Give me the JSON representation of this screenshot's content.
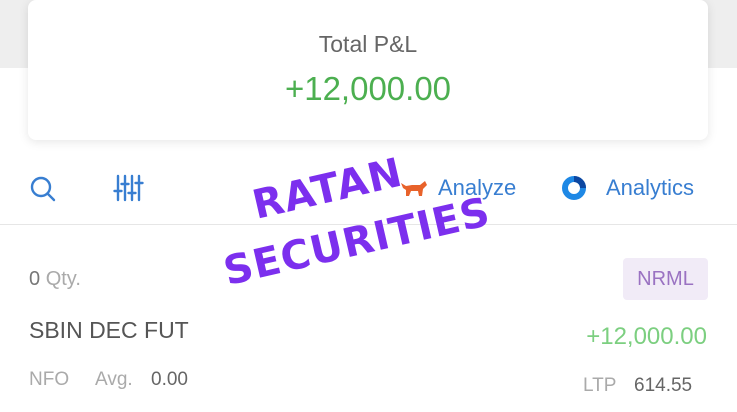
{
  "pnl_card": {
    "label": "Total P&L",
    "value": "+12,000.00"
  },
  "toolbar": {
    "search_icon": "search-icon",
    "filter_icon": "sliders-icon",
    "analyze_label": "Analyze",
    "analytics_label": "Analytics"
  },
  "position": {
    "qty_value": "0",
    "qty_unit": "Qty.",
    "product": "NRML",
    "instrument": "SBIN DEC FUT",
    "pnl": "+12,000.00",
    "exchange": "NFO",
    "avg_label": "Avg.",
    "avg_value": "0.00",
    "ltp_label": "LTP",
    "ltp_value": "614.55"
  },
  "watermark": {
    "line1": "RATAN",
    "line2": "SECURITIES"
  },
  "colors": {
    "accent": "#387ed1",
    "profit": "#4caf50",
    "watermark": "#7c2fee"
  }
}
